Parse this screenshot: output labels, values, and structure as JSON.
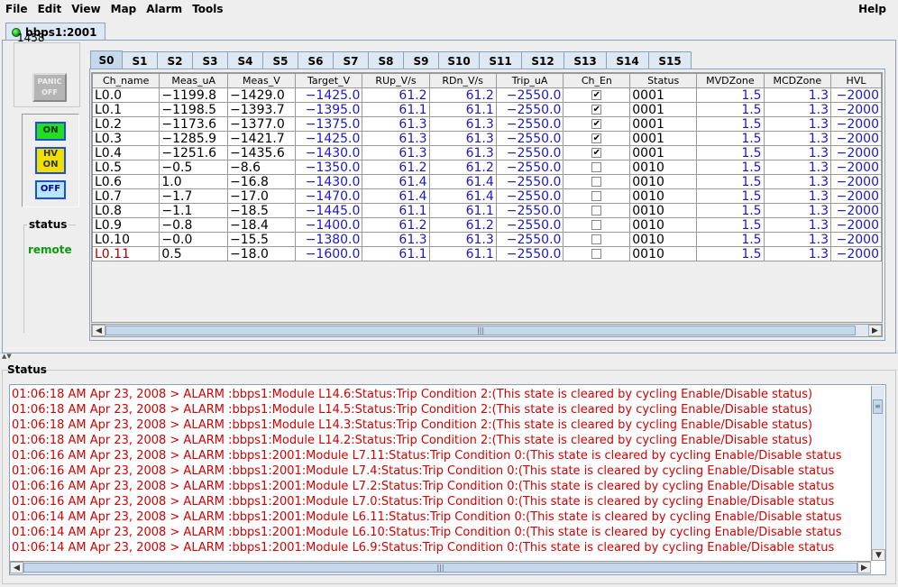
{
  "menu": {
    "items": [
      "File",
      "Edit",
      "View",
      "Map",
      "Alarm",
      "Tools"
    ],
    "help": "Help"
  },
  "window_tab": {
    "label": "bbps1:2001"
  },
  "control": {
    "id": "1458",
    "panic_label_1": "PANIC",
    "panic_label_2": "OFF",
    "on_label": "ON",
    "hvon_label_1": "HV",
    "hvon_label_2": "ON",
    "off_label": "OFF",
    "status_legend": "status",
    "status_value": "remote"
  },
  "subtabs": [
    "S0",
    "S1",
    "S2",
    "S3",
    "S4",
    "S5",
    "S6",
    "S7",
    "S8",
    "S9",
    "S10",
    "S11",
    "S12",
    "S13",
    "S14",
    "S15"
  ],
  "table": {
    "headers": [
      "Ch_name",
      "Meas_uA",
      "Meas_V",
      "Target_V",
      "RUp_V/s",
      "RDn_V/s",
      "Trip_uA",
      "Ch_En",
      "Status",
      "MVDZone",
      "MCDZone",
      "HVL"
    ],
    "rows": [
      {
        "name": "L0.0",
        "meas_ua": "−1199.8",
        "meas_v": "−1429.0",
        "target": "−1425.0",
        "rup": "61.2",
        "rdn": "61.2",
        "trip": "−2550.0",
        "en": true,
        "status": "0001",
        "mvd": "1.5",
        "mcd": "1.3",
        "hvl": "−2000",
        "alarm": false
      },
      {
        "name": "L0.1",
        "meas_ua": "−1198.5",
        "meas_v": "−1393.7",
        "target": "−1395.0",
        "rup": "61.1",
        "rdn": "61.1",
        "trip": "−2550.0",
        "en": true,
        "status": "0001",
        "mvd": "1.5",
        "mcd": "1.3",
        "hvl": "−2000",
        "alarm": false
      },
      {
        "name": "L0.2",
        "meas_ua": "−1173.6",
        "meas_v": "−1377.0",
        "target": "−1375.0",
        "rup": "61.3",
        "rdn": "61.3",
        "trip": "−2550.0",
        "en": true,
        "status": "0001",
        "mvd": "1.5",
        "mcd": "1.3",
        "hvl": "−2000",
        "alarm": false
      },
      {
        "name": "L0.3",
        "meas_ua": "−1285.9",
        "meas_v": "−1421.7",
        "target": "−1425.0",
        "rup": "61.3",
        "rdn": "61.3",
        "trip": "−2550.0",
        "en": true,
        "status": "0001",
        "mvd": "1.5",
        "mcd": "1.3",
        "hvl": "−2000",
        "alarm": false
      },
      {
        "name": "L0.4",
        "meas_ua": "−1251.6",
        "meas_v": "−1435.6",
        "target": "−1430.0",
        "rup": "61.3",
        "rdn": "61.3",
        "trip": "−2550.0",
        "en": true,
        "status": "0001",
        "mvd": "1.5",
        "mcd": "1.3",
        "hvl": "−2000",
        "alarm": false
      },
      {
        "name": "L0.5",
        "meas_ua": "−0.5",
        "meas_v": "−8.6",
        "target": "−1350.0",
        "rup": "61.2",
        "rdn": "61.2",
        "trip": "−2550.0",
        "en": false,
        "status": "0010",
        "mvd": "1.5",
        "mcd": "1.3",
        "hvl": "−2000",
        "alarm": false
      },
      {
        "name": "L0.6",
        "meas_ua": "1.0",
        "meas_v": "−16.8",
        "target": "−1430.0",
        "rup": "61.4",
        "rdn": "61.4",
        "trip": "−2550.0",
        "en": false,
        "status": "0010",
        "mvd": "1.5",
        "mcd": "1.3",
        "hvl": "−2000",
        "alarm": false
      },
      {
        "name": "L0.7",
        "meas_ua": "−1.7",
        "meas_v": "−17.0",
        "target": "−1470.0",
        "rup": "61.4",
        "rdn": "61.4",
        "trip": "−2550.0",
        "en": false,
        "status": "0010",
        "mvd": "1.5",
        "mcd": "1.3",
        "hvl": "−2000",
        "alarm": false
      },
      {
        "name": "L0.8",
        "meas_ua": "−1.1",
        "meas_v": "−18.5",
        "target": "−1445.0",
        "rup": "61.1",
        "rdn": "61.1",
        "trip": "−2550.0",
        "en": false,
        "status": "0010",
        "mvd": "1.5",
        "mcd": "1.3",
        "hvl": "−2000",
        "alarm": false
      },
      {
        "name": "L0.9",
        "meas_ua": "−0.8",
        "meas_v": "−18.4",
        "target": "−1400.0",
        "rup": "61.2",
        "rdn": "61.2",
        "trip": "−2550.0",
        "en": false,
        "status": "0010",
        "mvd": "1.5",
        "mcd": "1.3",
        "hvl": "−2000",
        "alarm": false
      },
      {
        "name": "L0.10",
        "meas_ua": "−0.0",
        "meas_v": "−15.5",
        "target": "−1380.0",
        "rup": "61.3",
        "rdn": "61.3",
        "trip": "−2550.0",
        "en": false,
        "status": "0010",
        "mvd": "1.5",
        "mcd": "1.3",
        "hvl": "−2000",
        "alarm": false
      },
      {
        "name": "L0.11",
        "meas_ua": "0.5",
        "meas_v": "−18.0",
        "target": "−1600.0",
        "rup": "61.1",
        "rdn": "61.1",
        "trip": "−2550.0",
        "en": false,
        "status": "0010",
        "mvd": "1.5",
        "mcd": "1.3",
        "hvl": "−2000",
        "alarm": true
      }
    ]
  },
  "status_panel": {
    "title": "Status",
    "lines": [
      "01:06:18 AM Apr 23, 2008 > ALARM :bbps1:Module L14.6:Status:Trip Condition 2:(This state is cleared by cycling Enable/Disable status)",
      "01:06:18 AM Apr 23, 2008 > ALARM :bbps1:Module L14.5:Status:Trip Condition 2:(This state is cleared by cycling Enable/Disable status)",
      "01:06:18 AM Apr 23, 2008 > ALARM :bbps1:Module L14.3:Status:Trip Condition 2:(This state is cleared by cycling Enable/Disable status)",
      "01:06:18 AM Apr 23, 2008 > ALARM :bbps1:Module L14.2:Status:Trip Condition 2:(This state is cleared by cycling Enable/Disable status)",
      "01:06:16 AM Apr 23, 2008 > ALARM :bbps1:2001:Module L7.11:Status:Trip Condition 0:(This state is cleared by cycling Enable/Disable status",
      "01:06:16 AM Apr 23, 2008 > ALARM :bbps1:2001:Module L7.4:Status:Trip Condition 0:(This state is cleared by cycling Enable/Disable status",
      "01:06:16 AM Apr 23, 2008 > ALARM :bbps1:2001:Module L7.2:Status:Trip Condition 0:(This state is cleared by cycling Enable/Disable status",
      "01:06:16 AM Apr 23, 2008 > ALARM :bbps1:2001:Module L7.0:Status:Trip Condition 0:(This state is cleared by cycling Enable/Disable status",
      "01:06:14 AM Apr 23, 2008 > ALARM :bbps1:2001:Module L6.11:Status:Trip Condition 0:(This state is cleared by cycling Enable/Disable status",
      "01:06:14 AM Apr 23, 2008 > ALARM :bbps1:2001:Module L6.10:Status:Trip Condition 0:(This state is cleared by cycling Enable/Disable status",
      "01:06:14 AM Apr 23, 2008 > ALARM :bbps1:2001:Module L6.9:Status:Trip Condition 0:(This state is cleared by cycling Enable/Disable status"
    ]
  },
  "colors": {
    "alarm_text": "#d60000",
    "alarm_cell": "#ff0000",
    "value_blue": "#1919c8",
    "remote_green": "#0e9a0e"
  }
}
